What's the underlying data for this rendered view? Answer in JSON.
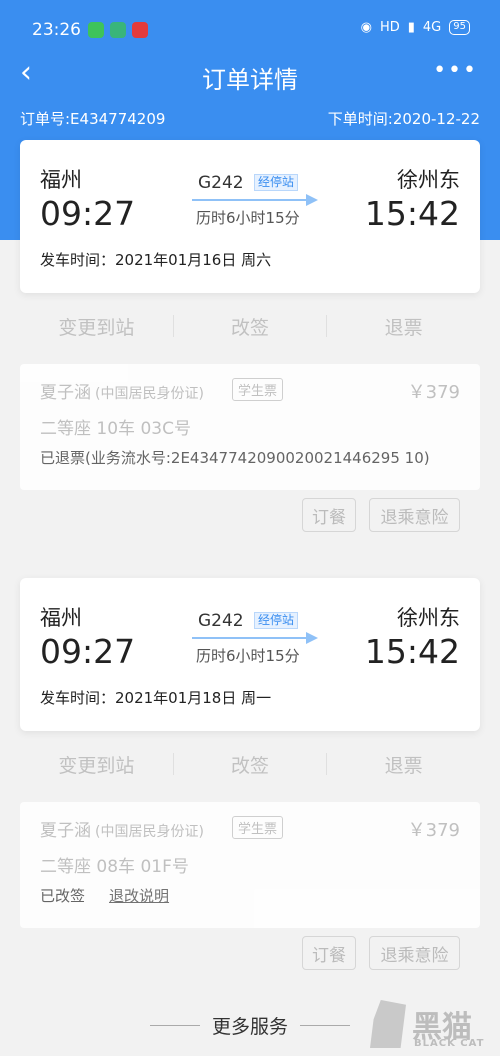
{
  "status_bar": {
    "time": "23:26",
    "apps": [
      {
        "name": "wechat-icon",
        "color": "#3ec35a",
        "glyph": "▪"
      },
      {
        "name": "notes-icon",
        "color": "#39b57a",
        "glyph": "≡"
      },
      {
        "name": "news-icon",
        "color": "#e33b3b",
        "glyph": "▪"
      }
    ],
    "network": "HD",
    "signal": "4G",
    "battery": "95"
  },
  "nav": {
    "back": "‹",
    "title": "订单详情",
    "more": "•••"
  },
  "order": {
    "number": "订单号:E434774209",
    "created": "下单时间:2020-12-22"
  },
  "trips": [
    {
      "from_station": "福州",
      "from_time": "09:27",
      "to_station": "徐州东",
      "to_time": "15:42",
      "train": "G242",
      "stops": "经停站",
      "duration": "历时6小时15分",
      "depart_date": "发车时间：2021年01月16日 周六",
      "actions": [
        "变更到站",
        "改签",
        "退票"
      ],
      "passenger": {
        "name": "夏子涵",
        "id_type": "(中国居民身份证)",
        "tag": "学生票",
        "price": "￥379",
        "seat": "二等座 10车 03C号",
        "status": "已退票(业务流水号:2E4347742090020021446295 10)",
        "rule": ""
      },
      "buttons": [
        "订餐",
        "退乘意险"
      ]
    },
    {
      "from_station": "福州",
      "from_time": "09:27",
      "to_station": "徐州东",
      "to_time": "15:42",
      "train": "G242",
      "stops": "经停站",
      "duration": "历时6小时15分",
      "depart_date": "发车时间：2021年01月18日 周一",
      "actions": [
        "变更到站",
        "改签",
        "退票"
      ],
      "passenger": {
        "name": "夏子涵",
        "id_type": "(中国居民身份证)",
        "tag": "学生票",
        "price": "￥379",
        "seat": "二等座 08车 01F号",
        "status": "已改签",
        "rule": "退改说明"
      },
      "buttons": [
        "订餐",
        "退乘意险"
      ]
    }
  ],
  "footer": {
    "more_services": "更多服务"
  },
  "watermark": {
    "text": "黑猫",
    "sub": "BLACK CAT"
  },
  "colors": {
    "accent": "#3a8ef0",
    "background": "#f2f2f2"
  }
}
